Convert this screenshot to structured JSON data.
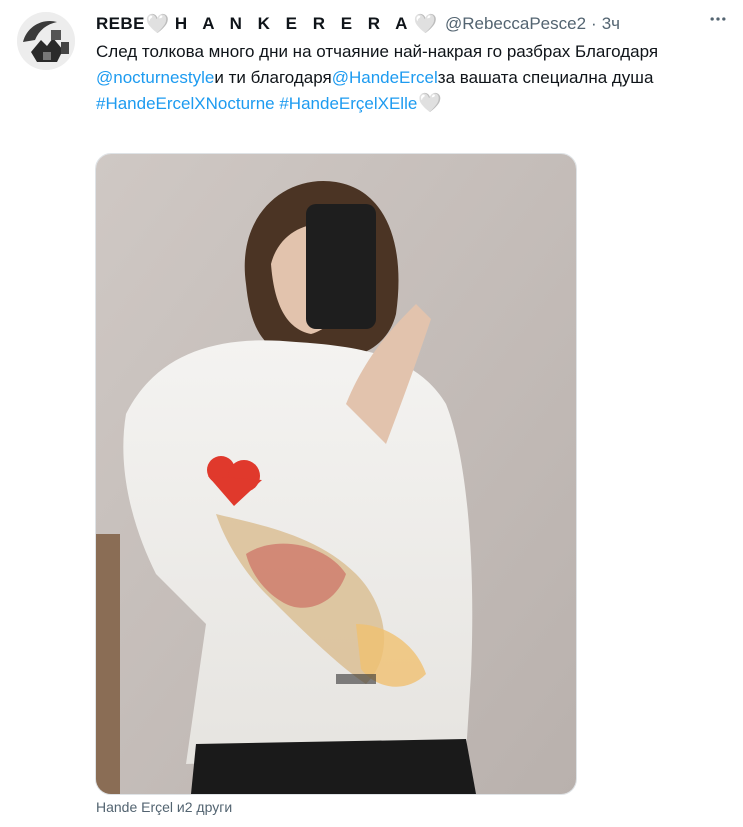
{
  "tweet": {
    "display_name_part1": "REBE",
    "display_name_part2": "H A N K E R E R A",
    "heart_glyph": "🤍",
    "handle": "@RebeccaPesce2",
    "separator": "·",
    "timestamp": "3ч",
    "text_1": "След толкова много дни на отчаяние най-накрая го разбрах Благодаря",
    "mention_1": "@nocturnestyle",
    "text_2": "и ти благодаря",
    "mention_2": "@HandeErcel",
    "text_3": "за вашата специална душа",
    "hashtag_1": "#HandeErcelXNocturne",
    "hashtag_2": "#HandeErçelXElle",
    "tagged_users": "Hande Erçel и2 други"
  },
  "icons": {
    "more": "more-horizontal-icon",
    "heart": "white-heart-icon"
  },
  "colors": {
    "link": "#1d9bf0",
    "secondary_text": "#536471",
    "primary_text": "#0f1419"
  }
}
